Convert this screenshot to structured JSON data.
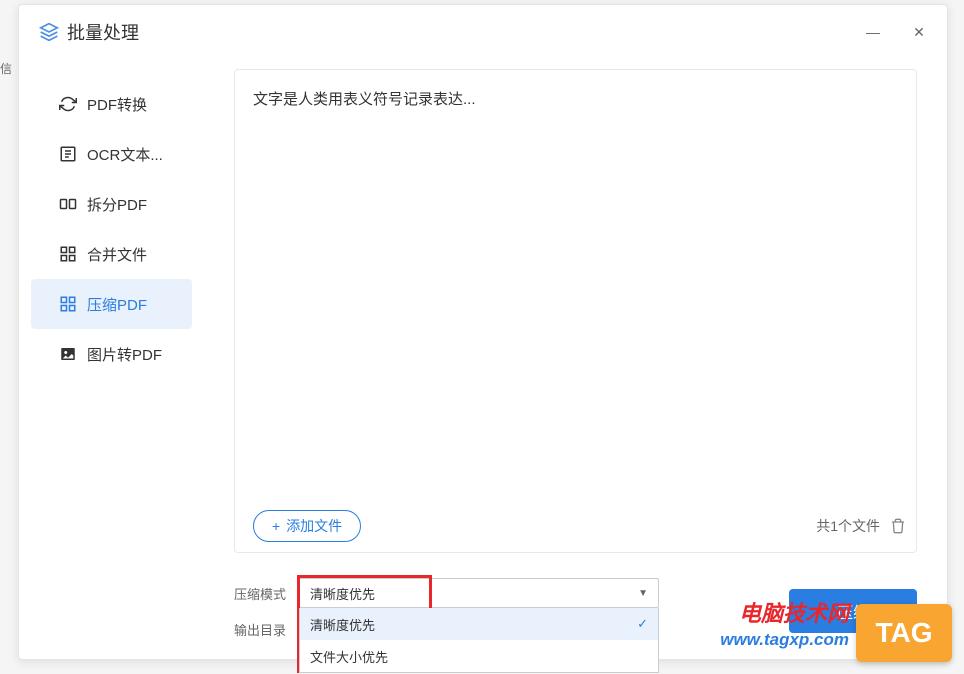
{
  "window": {
    "title": "批量处理"
  },
  "sidebar": {
    "items": [
      {
        "label": "PDF转换"
      },
      {
        "label": "OCR文本..."
      },
      {
        "label": "拆分PDF"
      },
      {
        "label": "合并文件"
      },
      {
        "label": "压缩PDF"
      },
      {
        "label": "图片转PDF"
      }
    ]
  },
  "main": {
    "file_preview": "文字是人类用表义符号记录表达...",
    "add_file_label": "添加文件",
    "file_count_text": "共1个文件"
  },
  "settings": {
    "mode_label": "压缩模式",
    "mode_value": "清晰度优先",
    "options": [
      {
        "label": "清晰度优先"
      },
      {
        "label": "文件大小优先"
      }
    ],
    "output_label": "输出目录"
  },
  "actions": {
    "compress_label": "压缩"
  },
  "watermark": {
    "tag": "TAG",
    "line1": "电脑技术网",
    "line2": "www.tagxp.com"
  },
  "edge_text": "信"
}
